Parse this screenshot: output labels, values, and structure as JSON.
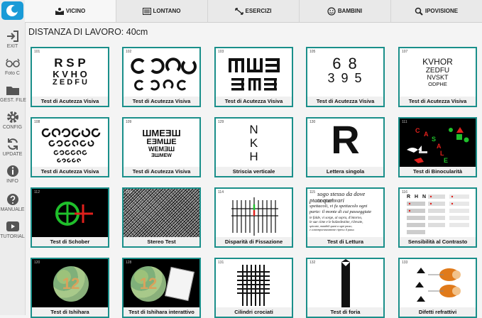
{
  "sidebar": {
    "items": [
      {
        "label": "EXIT",
        "icon": "exit-icon"
      },
      {
        "label": "Foto C",
        "icon": "glasses-icon"
      },
      {
        "label": "GEST. FILE",
        "icon": "folder-icon"
      },
      {
        "label": "CONFIG",
        "icon": "gear-icon"
      },
      {
        "label": "UPDATE",
        "icon": "refresh-icon"
      },
      {
        "label": "INFO",
        "icon": "info-icon"
      },
      {
        "label": "MANUALE",
        "icon": "help-icon"
      },
      {
        "label": "TUTORIAL",
        "icon": "play-icon"
      }
    ]
  },
  "tabs": [
    {
      "label": "VICINO",
      "icon": "book-reader-icon",
      "active": true
    },
    {
      "label": "LONTANO",
      "icon": "chart-board-icon",
      "active": false
    },
    {
      "label": "ESERCIZI",
      "icon": "arrows-icon",
      "active": false
    },
    {
      "label": "BAMBINI",
      "icon": "smiley-icon",
      "active": false
    },
    {
      "label": "IPOVISIONE",
      "icon": "magnifier-icon",
      "active": false
    }
  ],
  "heading": "DISTANZA DI LAVORO: 40cm",
  "cards": [
    {
      "num": "101",
      "label": "Test di Acutezza Visiva"
    },
    {
      "num": "102",
      "label": "Test di Acutezza Visiva"
    },
    {
      "num": "103",
      "label": "Test di Acutezza Visiva"
    },
    {
      "num": "105",
      "label": "Test di Acutezza Visiva"
    },
    {
      "num": "107",
      "label": "Test di Acutezza Visiva"
    },
    {
      "num": "108",
      "label": "Test di Acutezza Visiva"
    },
    {
      "num": "109",
      "label": "Test di Acutezza Visiva"
    },
    {
      "num": "129",
      "label": "Striscia verticale"
    },
    {
      "num": "130",
      "label": "Lettera singola"
    },
    {
      "num": "111",
      "label": "Test di Binocularità"
    },
    {
      "num": "112",
      "label": "Test di Schober"
    },
    {
      "num": "113",
      "label": "Stereo Test"
    },
    {
      "num": "114",
      "label": "Disparità di Fissazione"
    },
    {
      "num": "115",
      "label": "Test di Lettura"
    },
    {
      "num": "116",
      "label": "Sensibilità al Contrasto"
    },
    {
      "num": "120",
      "label": "Test di Ishihara"
    },
    {
      "num": "128",
      "label": "Test di Ishihara interattivo"
    },
    {
      "num": "131",
      "label": "Cilindri crociati"
    },
    {
      "num": "132",
      "label": "Test di foria"
    },
    {
      "num": "133",
      "label": "Difetti refrattivi"
    }
  ],
  "art": {
    "c101": [
      "R S P",
      "K V H O",
      "Z E D F U"
    ],
    "c103": [
      "ꟽ Ш Ǝ",
      "Ǝ M Ǝ"
    ],
    "c105": [
      "6 8",
      "3 9 5"
    ],
    "c107": [
      "KVHOR",
      "ZEDFU",
      "NVSKT",
      "ODPHE"
    ],
    "c109": [
      "ШMEƎШ",
      "EƎMШE",
      "WEMƎШ",
      "ƎШMEW"
    ],
    "c129": [
      "N",
      "K",
      "H"
    ],
    "c130": "R",
    "c111": [
      "C",
      "A",
      "S",
      "A",
      "L",
      "E"
    ],
    "c115": [
      "sogo stesso da dove contem",
      "ptate que' vari",
      "spettacoli, vi fu spettacolo ogni",
      "parte: il monte di cui passeggiate",
      "le falde, vi sorge, al sopra, d'intorno,",
      "le sue cime e le balzedestine, rilevate,",
      "spiccate, mutabili quasi a ogni passo,",
      "e contemporaneamente ripreso il passo"
    ],
    "c115num": "115",
    "c116": [
      "R",
      "H",
      "N"
    ],
    "c120": "12",
    "colors": {
      "teal": "#1a8f8a",
      "green": "#1fbf2b",
      "red": "#e0201c"
    }
  }
}
